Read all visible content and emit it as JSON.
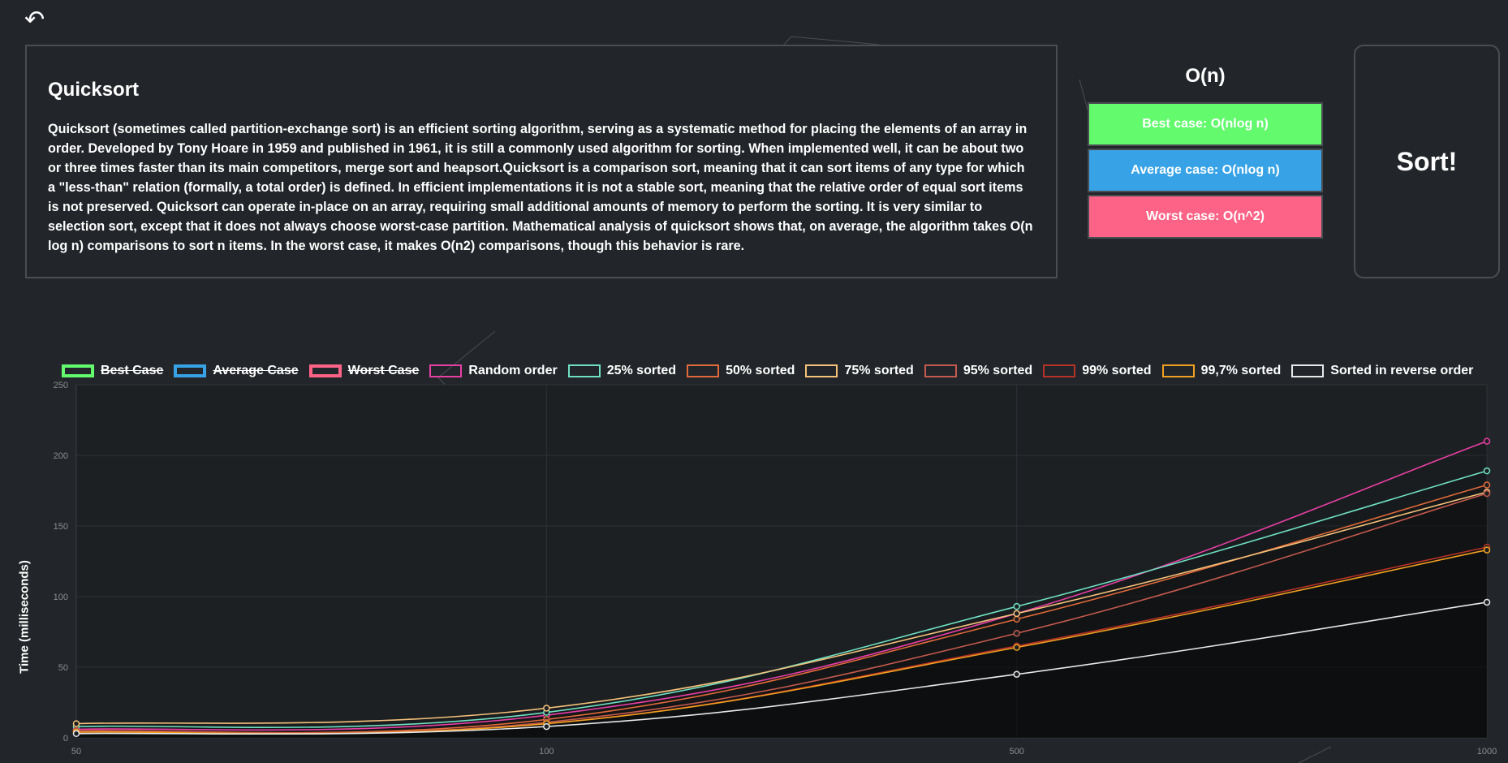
{
  "nav": {
    "back_icon": "undo-arrow-icon",
    "back_glyph": "↶"
  },
  "description": {
    "title": "Quicksort",
    "text": "Quicksort (sometimes called partition-exchange sort) is an efficient sorting algorithm, serving as a systematic method for placing the elements of an array in order. Developed by Tony Hoare in 1959 and published in 1961, it is still a commonly used algorithm for sorting. When implemented well, it can be about two or three times faster than its main competitors, merge sort and heapsort.Quicksort is a comparison sort, meaning that it can sort items of any type for which a \"less-than\" relation (formally, a total order) is defined. In efficient implementations it is not a stable sort, meaning that the relative order of equal sort items is not preserved. Quicksort can operate in-place on an array, requiring small additional amounts of memory to perform the sorting. It is very similar to selection sort, except that it does not always choose worst-case partition. Mathematical analysis of quicksort shows that, on average, the algorithm takes O(n log n) comparisons to sort n items. In the worst case, it makes O(n2) comparisons, though this behavior is rare."
  },
  "complexity": {
    "title": "O(n)",
    "best": "Best case: O(nlog n)",
    "average": "Average case: O(nlog n)",
    "worst": "Worst case: O(n^2)",
    "colors": {
      "best": "#63fa6e",
      "average": "#37a3e6",
      "worst": "#fd6386"
    }
  },
  "sort_button": {
    "label": "Sort!"
  },
  "chart_data": {
    "type": "line",
    "categories": [
      "50",
      "100",
      "500",
      "1000"
    ],
    "ylabel": "Time (milliseconds)",
    "ylim": [
      0,
      250
    ],
    "yticks": [
      "0",
      "50",
      "100",
      "150",
      "200",
      "250"
    ],
    "grid": true,
    "legend_position": "top",
    "series": [
      {
        "name": "Best Case",
        "color": "#63fa6e",
        "hidden": true,
        "values": []
      },
      {
        "name": "Average Case",
        "color": "#37a3e6",
        "hidden": true,
        "values": []
      },
      {
        "name": "Worst Case",
        "color": "#fd6386",
        "hidden": true,
        "values": []
      },
      {
        "name": "Random order",
        "color": "#e83fa6",
        "hidden": false,
        "values": [
          6,
          16,
          88,
          210
        ]
      },
      {
        "name": "25% sorted",
        "color": "#6fe0c3",
        "hidden": false,
        "values": [
          8,
          18,
          93,
          189
        ]
      },
      {
        "name": "50% sorted",
        "color": "#e06a3a",
        "hidden": false,
        "values": [
          5,
          13,
          84,
          179
        ]
      },
      {
        "name": "75% sorted",
        "color": "#f5c27a",
        "hidden": false,
        "values": [
          10,
          21,
          88,
          174
        ]
      },
      {
        "name": "95% sorted",
        "color": "#c45a4e",
        "hidden": false,
        "values": [
          5,
          11,
          74,
          173
        ]
      },
      {
        "name": "99% sorted",
        "color": "#b83227",
        "hidden": false,
        "values": [
          4,
          10,
          65,
          135
        ]
      },
      {
        "name": "99,7% sorted",
        "color": "#f0a020",
        "hidden": false,
        "values": [
          4,
          10,
          64,
          133
        ]
      },
      {
        "name": "Sorted in reverse order",
        "color": "#e8e8e8",
        "hidden": false,
        "values": [
          3,
          8,
          45,
          96
        ]
      }
    ]
  }
}
